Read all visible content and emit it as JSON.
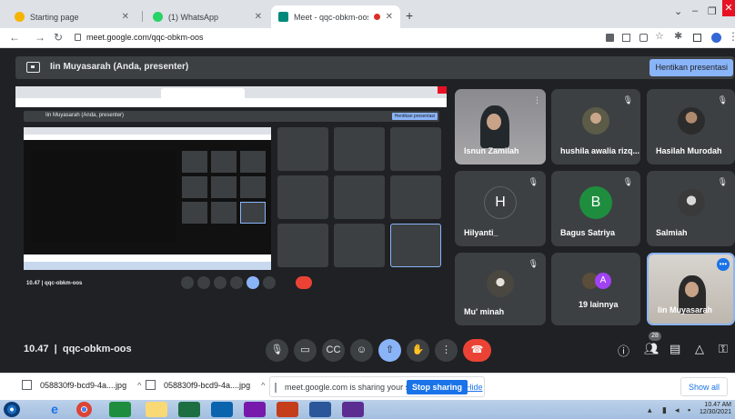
{
  "browser": {
    "tabs": [
      {
        "title": "Starting page",
        "active": false
      },
      {
        "title": "(1) WhatsApp",
        "active": false
      },
      {
        "title": "Meet - qqc-obkm-oos",
        "active": true
      }
    ],
    "url": "meet.google.com/qqc-obkm-oos"
  },
  "meet": {
    "presenter_label": "Iin Muyasarah (Anda, presenter)",
    "stop_presenting": "Hentikan presentasi",
    "participants": [
      {
        "name": "Isnun Zamilah",
        "kind": "photo"
      },
      {
        "name": "hushila awalia rizq...",
        "kind": "photo"
      },
      {
        "name": "Hasilah Murodah",
        "kind": "photo"
      },
      {
        "name": "Hilyanti_",
        "kind": "initial",
        "initial": "H",
        "color": "#3c4043"
      },
      {
        "name": "Bagus Satriya",
        "kind": "initial",
        "initial": "B",
        "color": "#1e8e3e"
      },
      {
        "name": "Salmiah",
        "kind": "photo"
      },
      {
        "name": "Mu' minah",
        "kind": "photo"
      },
      {
        "name": "19 lainnya",
        "kind": "others",
        "initial": "A"
      },
      {
        "name": "Iin Muyasarah",
        "kind": "self"
      }
    ],
    "meeting_time": "10.47",
    "meeting_code": "qqc-obkm-oos",
    "participant_count": "28"
  },
  "shared_screen": {
    "presenter_label": "Iin Muyasarah (Anda, presenter)",
    "stop_presenting": "Hentikan presentasi",
    "meeting_info": "10.47 | qqc-obkm-oos"
  },
  "downloads": {
    "items": [
      {
        "name": "058830f9-bcd9-4a....jpg"
      },
      {
        "name": "058830f9-bcd9-4a....jpg"
      }
    ],
    "sharing_message": "meet.google.com is sharing your screen.",
    "stop_sharing": "Stop sharing",
    "hide": "Hide",
    "show_all": "Show all"
  },
  "taskbar": {
    "time": "10.47 AM",
    "date": "12/30/2021"
  },
  "colors": {
    "meet_bg": "#202124",
    "tile_bg": "#3c4043",
    "accent": "#8ab4f8",
    "leave": "#ea4335"
  }
}
